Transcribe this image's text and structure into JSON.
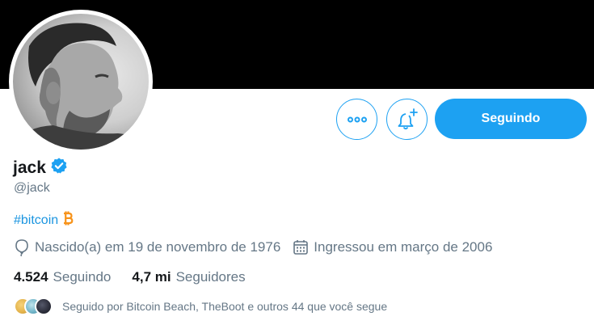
{
  "profile": {
    "display_name": "jack",
    "handle": "@jack",
    "bio_hashtag": "#bitcoin",
    "birth_text": "Nascido(a) em 19 de novembro de 1976",
    "joined_text": "Ingressou em março de 2006"
  },
  "actions": {
    "following_label": "Seguindo"
  },
  "stats": {
    "following_count": "4.524",
    "following_label": "Seguindo",
    "followers_count": "4,7 mi",
    "followers_label": "Seguidores"
  },
  "followed_by": {
    "text": "Seguido por Bitcoin Beach, TheBoot e outros 44 que você segue",
    "avatar_colors": [
      "#e3b24a",
      "#6fb3c8",
      "#2b2d3a"
    ]
  },
  "colors": {
    "accent": "#1da1f2",
    "banner": "#000000",
    "muted_text": "#657786",
    "bitcoin": "#f7931a"
  },
  "icons": {
    "more": "more-icon",
    "bell_plus": "bell-plus-icon",
    "verified": "verified-badge-icon",
    "bitcoin": "bitcoin-icon",
    "balloon": "balloon-icon",
    "calendar": "calendar-icon"
  }
}
